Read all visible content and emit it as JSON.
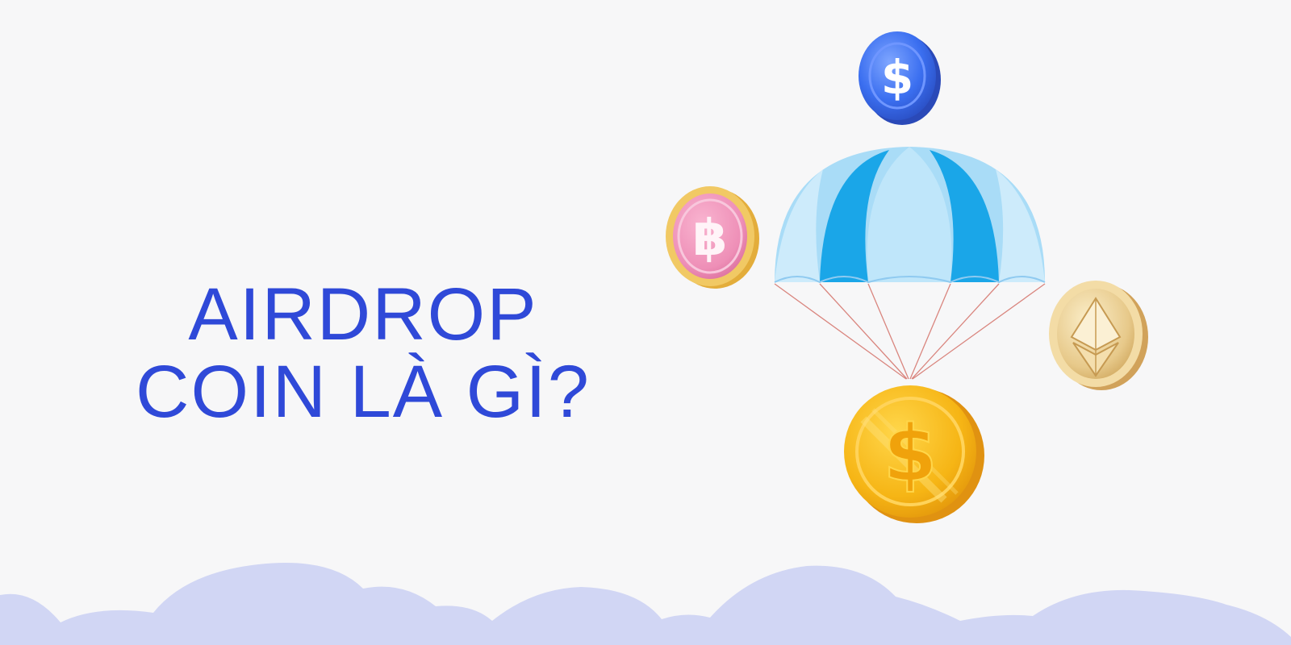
{
  "headline": {
    "line1": "AIRDROP",
    "line2": "COIN LÀ GÌ?"
  },
  "colors": {
    "background": "#f7f7f8",
    "headline": "#2f49d8",
    "clouds": "#d1d6f4",
    "parachute_light": "#a9dcf7",
    "parachute_dark": "#1aa6e8",
    "gold_coin": "#f6b515",
    "blue_coin": "#3b6ff0",
    "pink_coin": "#ee8fb7",
    "eth_coin": "#e7c98a"
  },
  "icons": {
    "top_coin": "dollar-coin-icon",
    "left_coin": "bitcoin-coin-icon",
    "right_coin": "ethereum-coin-icon",
    "bottom_coin": "dollar-gold-coin-icon",
    "parachute": "parachute-icon"
  }
}
